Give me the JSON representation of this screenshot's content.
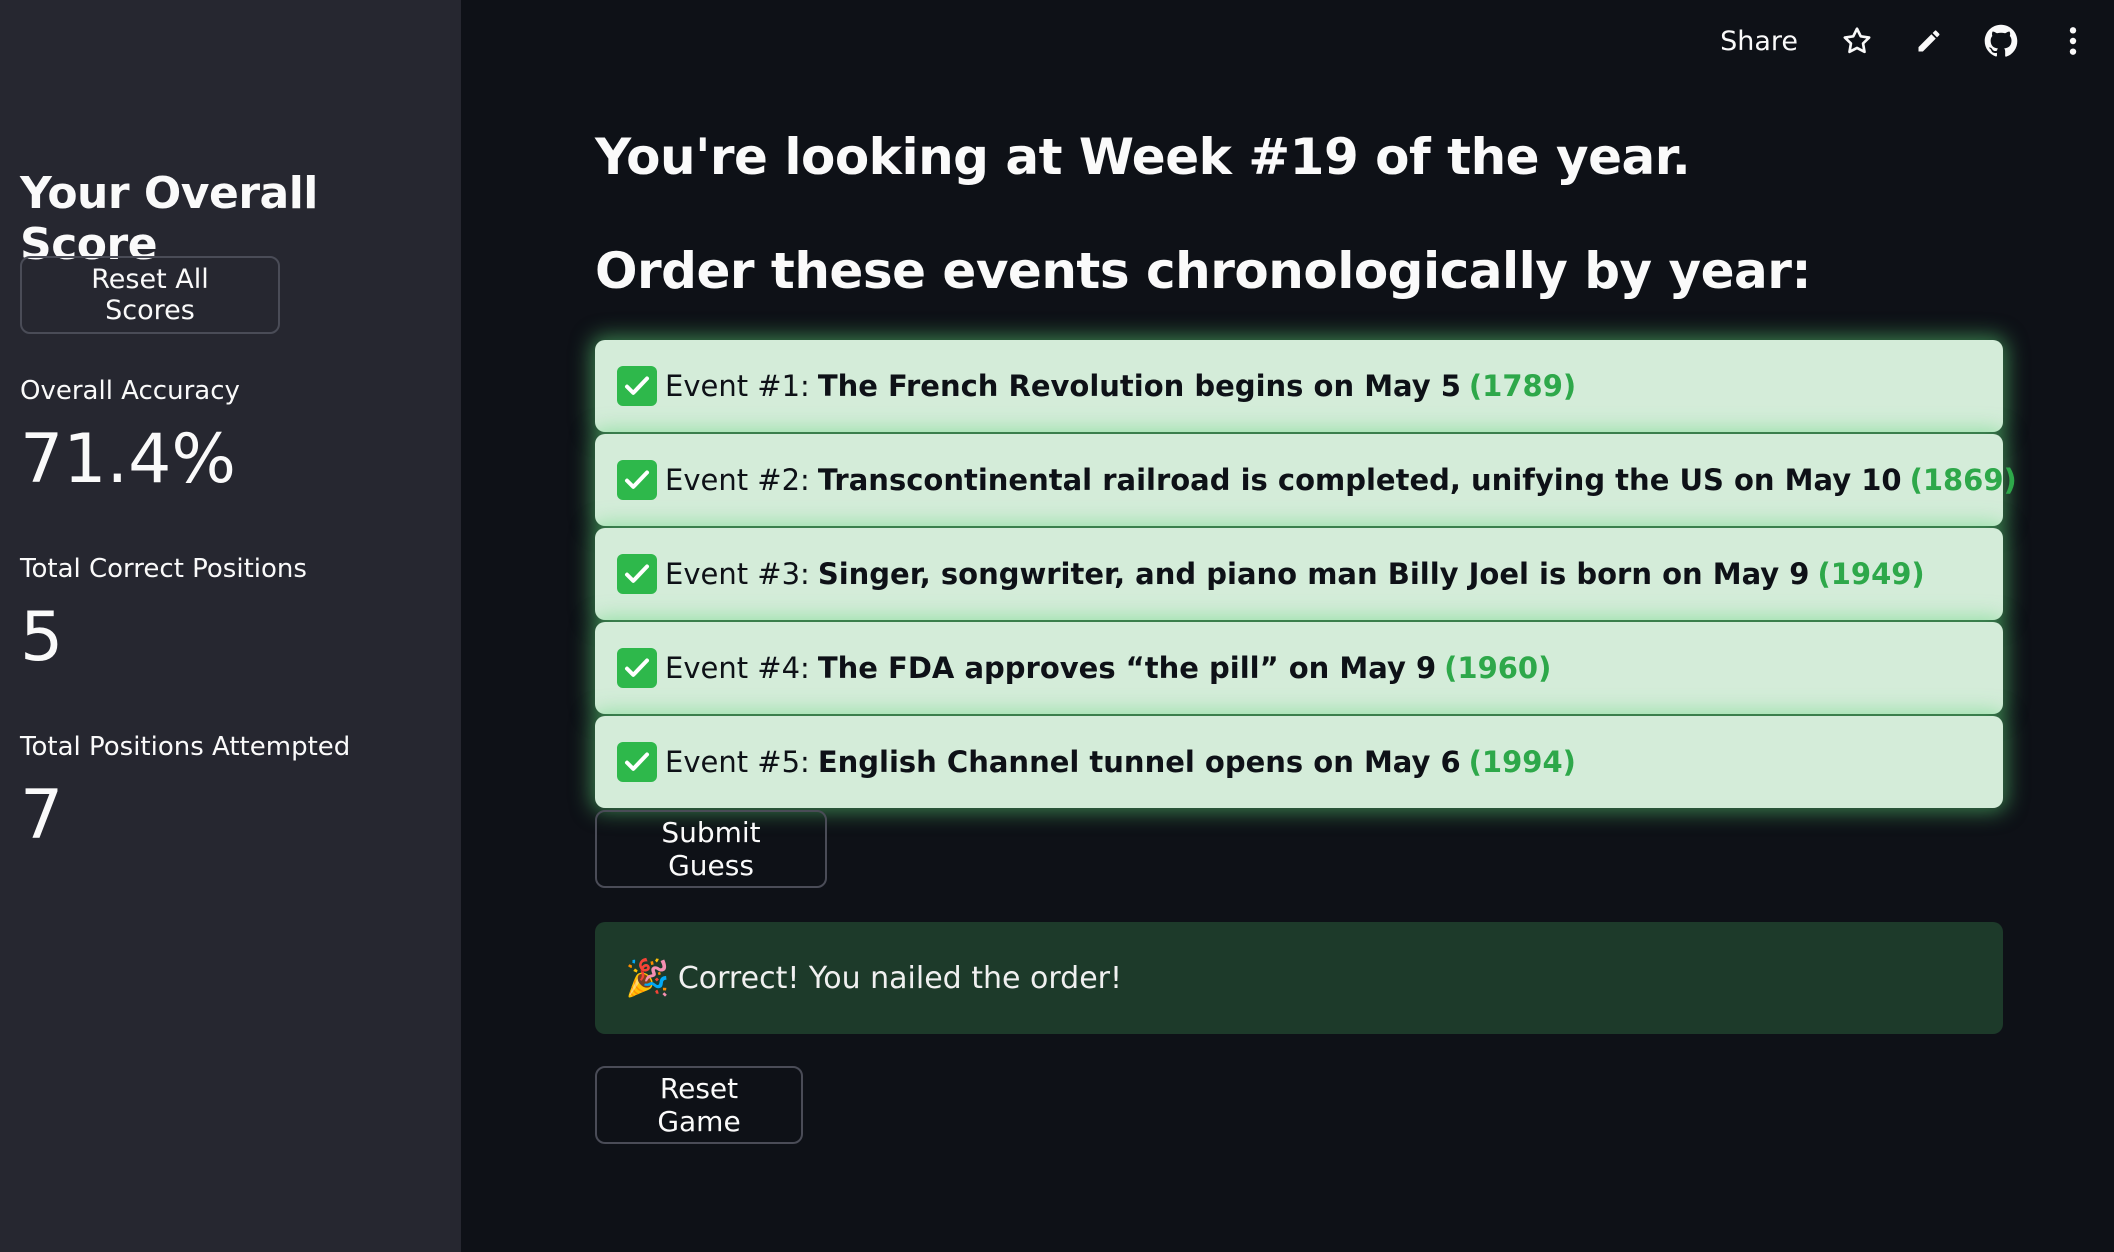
{
  "sidebar": {
    "title": "Your Overall Score",
    "reset_scores_label": "Reset All Scores",
    "metrics": [
      {
        "label": "Overall Accuracy",
        "value": "71.4%"
      },
      {
        "label": "Total Correct Positions",
        "value": "5"
      },
      {
        "label": "Total Positions Attempted",
        "value": "7"
      }
    ]
  },
  "toolbar": {
    "share_label": "Share",
    "icons": [
      "star-icon",
      "pencil-icon",
      "github-icon",
      "more-vert-icon"
    ]
  },
  "main": {
    "heading": "You're looking at Week #19 of the year.",
    "subheading": "Order these events chronologically by year:",
    "events": [
      {
        "number": "Event #1:",
        "text": "The French Revolution begins on May 5",
        "year": "(1789)"
      },
      {
        "number": "Event #2:",
        "text": "Transcontinental railroad is completed, unifying the US on May 10",
        "year": "(1869)"
      },
      {
        "number": "Event #3:",
        "text": "Singer, songwriter, and piano man Billy Joel is born on May 9",
        "year": "(1949)"
      },
      {
        "number": "Event #4:",
        "text": "The FDA approves “the pill” on May 9",
        "year": "(1960)"
      },
      {
        "number": "Event #5:",
        "text": "English Channel tunnel opens on May 6",
        "year": "(1994)"
      }
    ],
    "submit_label": "Submit Guess",
    "success_message": "Correct! You nailed the order!",
    "reset_game_label": "Reset Game"
  },
  "colors": {
    "background": "#0e1117",
    "sidebar": "#262730",
    "event_bg": "#d4ecd9",
    "year_green": "#2ea84a",
    "success_bg": "#1d3a2a",
    "check_green": "#2eb84b"
  }
}
